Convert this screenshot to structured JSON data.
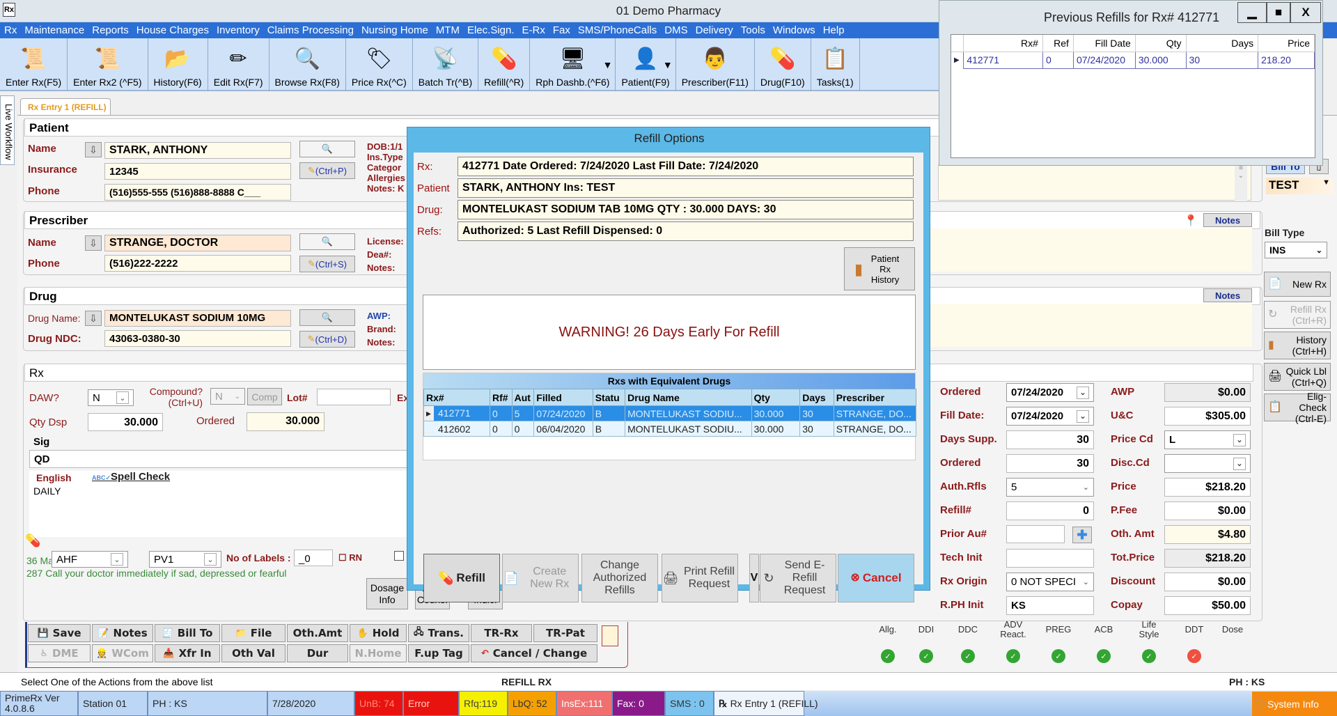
{
  "window": {
    "title": "01 Demo Pharmacy",
    "app_icon": "Rx"
  },
  "menu": [
    "Rx",
    "Maintenance",
    "Reports",
    "House Charges",
    "Inventory",
    "Claims Processing",
    "Nursing Home",
    "MTM",
    "Elec.Sign.",
    "E-Rx",
    "Fax",
    "SMS/PhoneCalls",
    "DMS",
    "Delivery",
    "Tools",
    "Windows",
    "Help"
  ],
  "toolbar": [
    {
      "label": "Enter Rx(F5)",
      "icon": "new-rx-icon",
      "glyph": "📜"
    },
    {
      "label": "Enter Rx2 (^F5)",
      "icon": "new-rx2-icon",
      "glyph": "📜"
    },
    {
      "label": "History(F6)",
      "icon": "folder-history-icon",
      "glyph": "📂"
    },
    {
      "label": "Edit Rx(F7)",
      "icon": "pencil-icon",
      "glyph": "✏"
    },
    {
      "label": "Browse Rx(F8)",
      "icon": "magnifier-icon",
      "glyph": "🔍"
    },
    {
      "label": "Price Rx(^C)",
      "icon": "price-tag-icon",
      "glyph": "🏷"
    },
    {
      "label": "Batch Tr(^B)",
      "icon": "tower-icon",
      "glyph": "📡"
    },
    {
      "label": "Refill(^R)",
      "icon": "refill-bottle-icon",
      "glyph": "💊"
    },
    {
      "label": "Rph Dashb.(^F6)",
      "icon": "dashboard-icon",
      "glyph": "🖥",
      "dropdown": true
    },
    {
      "label": "Patient(F9)",
      "icon": "patient-icon",
      "glyph": "👤",
      "dropdown": true
    },
    {
      "label": "Prescriber(F11)",
      "icon": "prescriber-icon",
      "glyph": "👨"
    },
    {
      "label": "Drug(F10)",
      "icon": "pill-icon",
      "glyph": "💊"
    },
    {
      "label": "Tasks(1)",
      "icon": "tasks-icon",
      "glyph": "📋"
    }
  ],
  "side_tab": "Live Workflow",
  "tab": "Rx Entry 1 (REFILL)",
  "patient": {
    "header": "Patient",
    "name_label": "Name",
    "name": "STARK, ANTHONY",
    "insurance_label": "Insurance",
    "insurance": "12345",
    "phone_label": "Phone",
    "phone": "(516)555-555  (516)888-8888 C___",
    "edit_shortcut": "(Ctrl+P)",
    "info": [
      "DOB:1/1",
      "Ins.Type",
      "Categor",
      "Allergies",
      "Notes: K"
    ]
  },
  "prescriber": {
    "header": "Prescriber",
    "name_label": "Name",
    "name": "STRANGE, DOCTOR",
    "phone_label": "Phone",
    "phone": "(516)222-2222",
    "edit_shortcut": "(Ctrl+S)",
    "info": [
      "License:",
      "Dea#:",
      "Notes:"
    ],
    "notes_button": "Notes"
  },
  "drug": {
    "header": "Drug",
    "name_label": "Drug Name:",
    "name": "MONTELUKAST SODIUM 10MG",
    "ndc_label": "Drug NDC:",
    "ndc": "43063-0380-30",
    "edit_shortcut": "(Ctrl+D)",
    "info": [
      "AWP:",
      "Brand:",
      "Notes:"
    ],
    "notes_button": "Notes"
  },
  "rx": {
    "header": "Rx",
    "daw_label": "DAW?",
    "daw": "N",
    "compound_label": "Compound?",
    "compound_shortcut": "(Ctrl+U)",
    "compound": "N",
    "comp_button": "Comp",
    "lot_label": "Lot#",
    "lot": "",
    "exp_label": "Ex",
    "qty_label": "Qty Dsp",
    "qty": "30.000",
    "ordered_label": "Ordered",
    "ordered": "30.000",
    "sig_label": "Sig",
    "sig": "QD",
    "lang_label": "English",
    "spell_check": "Spell Check",
    "sig_text": "DAILY",
    "warn_prefix": "36 Ma",
    "aux1": "AHF",
    "aux2": "PV1",
    "labels_label": "No of Labels :",
    "labels": "_0",
    "rn_label": "RN",
    "warning_text": "287 Call your doctor immediately if sad, depressed or fearful",
    "buttons": [
      "Dosage Info",
      "Drug Couns.",
      "Drug Indic."
    ]
  },
  "right_fields": {
    "left": [
      {
        "label": "Ordered",
        "value": "07/24/2020",
        "type": "date"
      },
      {
        "label": "Fill Date:",
        "value": "07/24/2020",
        "type": "date"
      },
      {
        "label": "Days Supp.",
        "value": "30",
        "type": "num"
      },
      {
        "label": "Ordered",
        "value": "30",
        "type": "num"
      },
      {
        "label": "Auth.Rfls",
        "value": "5",
        "type": "select"
      },
      {
        "label": "Refill#",
        "value": "0",
        "type": "num"
      },
      {
        "label": "Prior Au#",
        "value": "",
        "type": "prior"
      },
      {
        "label": "Tech Init",
        "value": "",
        "type": "text"
      },
      {
        "label": "Rx Origin",
        "value": "0  NOT SPECI",
        "type": "select"
      },
      {
        "label": "R.PH Init",
        "value": "KS",
        "type": "text"
      }
    ],
    "right": [
      {
        "label": "AWP",
        "value": "$0.00",
        "style": "gray"
      },
      {
        "label": "U&C",
        "value": "$305.00",
        "style": "white"
      },
      {
        "label": "Price Cd",
        "value": "L",
        "style": "select"
      },
      {
        "label": "Disc.Cd",
        "value": "",
        "style": "select"
      },
      {
        "label": "Price",
        "value": "$218.20",
        "style": "white"
      },
      {
        "label": "P.Fee",
        "value": "$0.00",
        "style": "white"
      },
      {
        "label": "Oth. Amt",
        "value": "$4.80",
        "style": "yellow"
      },
      {
        "label": "Tot.Price",
        "value": "$218.20",
        "style": "gray"
      },
      {
        "label": "Discount",
        "value": "$0.00",
        "style": "white"
      },
      {
        "label": "Copay",
        "value": "$50.00",
        "style": "white"
      }
    ]
  },
  "billing": {
    "bill_to_button": "Bill To",
    "bill_to": "TEST",
    "bill_type_label": "Bill Type",
    "bill_type": "INS"
  },
  "side_buttons": [
    {
      "label": "New Rx",
      "icon": "new-rx-icon",
      "disabled": false
    },
    {
      "label": "Refill Rx (Ctrl+R)",
      "icon": "refill-icon",
      "disabled": true
    },
    {
      "label": "History (Ctrl+H)",
      "icon": "history-scroll-icon",
      "disabled": false
    },
    {
      "label": "Quick Lbl (Ctrl+Q)",
      "icon": "printer-icon",
      "disabled": false
    },
    {
      "label": "Elig-Check (Ctrl-E)",
      "icon": "elig-check-icon",
      "disabled": false
    }
  ],
  "checks": [
    {
      "label": "Allg.",
      "status": "ok"
    },
    {
      "label": "DDI",
      "status": "ok"
    },
    {
      "label": "DDC",
      "status": "ok"
    },
    {
      "label": "ADV React.",
      "status": "ok"
    },
    {
      "label": "PREG",
      "status": "ok"
    },
    {
      "label": "ACB",
      "status": "ok"
    },
    {
      "label": "Life Style",
      "status": "ok"
    },
    {
      "label": "DDT",
      "status": "alert"
    },
    {
      "label": "Dose",
      "status": "none"
    }
  ],
  "actions_row1": [
    {
      "label": "Save",
      "icon": "save-icon"
    },
    {
      "label": "Notes",
      "icon": "notes-icon"
    },
    {
      "label": "Bill To",
      "icon": "bill-icon"
    },
    {
      "label": "File",
      "icon": "file-icon"
    },
    {
      "label": "Oth.Amt",
      "icon": ""
    },
    {
      "label": "Hold",
      "icon": "hand-icon"
    },
    {
      "label": "Trans.",
      "icon": "transfer-icon"
    },
    {
      "label": "TR-Rx",
      "icon": ""
    },
    {
      "label": "TR-Pat",
      "icon": ""
    }
  ],
  "actions_row2": [
    {
      "label": "DME",
      "icon": "wheelchair-icon",
      "disabled": true
    },
    {
      "label": "WCom",
      "icon": "worker-icon",
      "disabled": true
    },
    {
      "label": "Xfr In",
      "icon": "xfer-in-icon"
    },
    {
      "label": "Oth Val",
      "icon": ""
    },
    {
      "label": "Dur",
      "icon": ""
    },
    {
      "label": "N.Home",
      "icon": "",
      "disabled": true
    },
    {
      "label": "F.up Tag",
      "icon": ""
    },
    {
      "label": "Cancel / Change",
      "icon": "undo-icon"
    }
  ],
  "status": {
    "message": "Select One of the Actions from the above list",
    "mode": "REFILL RX",
    "user": "PH : KS"
  },
  "taskbar": [
    {
      "label": "PrimeRx Ver 4.0.8.6",
      "bg": "#bcd6f5",
      "color": "#222"
    },
    {
      "label": "Station 01",
      "bg": "#bcd6f5",
      "color": "#222"
    },
    {
      "label": "PH : KS",
      "bg": "#bcd6f5",
      "color": "#222"
    },
    {
      "label": "7/28/2020",
      "bg": "#bcd6f5",
      "color": "#222"
    },
    {
      "label": "UnB: 74",
      "bg": "#e8130f",
      "color": "#ff8a7a"
    },
    {
      "label": "Error",
      "bg": "#e8130f",
      "color": "#ffd0c8"
    },
    {
      "label": "Rfq:119",
      "bg": "#f4f000",
      "color": "#444"
    },
    {
      "label": "LbQ: 52",
      "bg": "#f5a000",
      "color": "#333"
    },
    {
      "label": "InsEx:111",
      "bg": "#f07070",
      "color": "#fff"
    },
    {
      "label": "Fax: 0",
      "bg": "#8a1a8a",
      "color": "#fff"
    },
    {
      "label": "SMS : 0",
      "bg": "#7cc4ef",
      "color": "#333"
    },
    {
      "label": "Rx Entry 1 (REFILL)",
      "bg": "#eef4fb",
      "color": "#222"
    }
  ],
  "system_info": "System Info",
  "refill_dialog": {
    "title": "Refill Options",
    "rows": [
      {
        "label": "Rx:",
        "value": "412771   Date Ordered: 7/24/2020   Last Fill Date: 7/24/2020"
      },
      {
        "label": "Patient",
        "value": "STARK, ANTHONY    Ins: TEST"
      },
      {
        "label": "Drug:",
        "value": "MONTELUKAST SODIUM TAB 10MG  QTY : 30.000   DAYS: 30"
      },
      {
        "label": "Refs:",
        "value": "Authorized: 5     Last Refill Dispensed: 0"
      }
    ],
    "history_button": "Patient Rx History",
    "warning": "WARNING! 26 Days Early For Refill",
    "grid_title": "Rxs with Equivalent Drugs",
    "columns": [
      "Rx#",
      "Rf#",
      "Aut",
      "Filled",
      "Statu",
      "Drug Name",
      "Qty",
      "Days",
      "Prescriber"
    ],
    "rows_data": [
      [
        "412771",
        "0",
        "5",
        "07/24/2020",
        "B",
        "MONTELUKAST  SODIU...",
        "30.000",
        "30",
        "STRANGE, DO..."
      ],
      [
        "412602",
        "0",
        "0",
        "06/04/2020",
        "B",
        "MONTELUKAST  SODIU...",
        "30.000",
        "30",
        "STRANGE, DO..."
      ]
    ],
    "buttons": [
      "Refill",
      "Create New Rx",
      "Change Authorized Refills",
      "Print Refill Request",
      "V",
      "Send E-Refill Request",
      "Cancel"
    ]
  },
  "prev_refills": {
    "title": "Previous Refills for Rx# 412771",
    "columns": [
      "Rx#",
      "Ref",
      "Fill Date",
      "Qty",
      "Days",
      "Price"
    ],
    "rows": [
      [
        "412771",
        "0",
        "07/24/2020",
        "30.000",
        "30",
        "218.20"
      ]
    ]
  }
}
